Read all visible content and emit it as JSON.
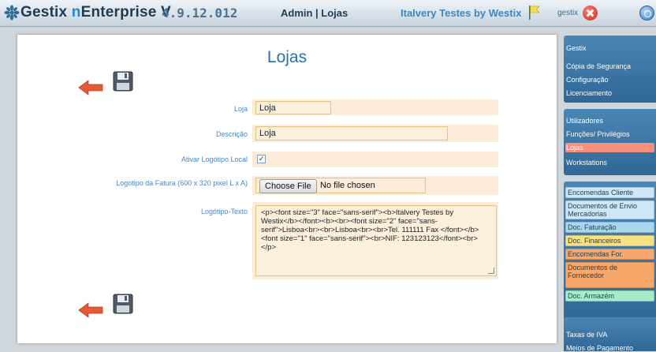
{
  "header": {
    "brand_prefix": "Gestix ",
    "brand_n": "n",
    "brand_suffix": "Enterprise V",
    "version": "4.9.12.012",
    "breadcrumb": "Admin | Lojas",
    "company": "Italvery Testes by Westix",
    "user": "gestix",
    "icons": [
      "gestix-star-icon",
      "flag-icon",
      "close-icon",
      "info-icon"
    ]
  },
  "page": {
    "title": "Lojas"
  },
  "form": {
    "loja_label": "Loja",
    "loja_value": "Loja",
    "descricao_label": "Descrição",
    "descricao_value": "Loja",
    "ativar_label": "Ativar Logótipo Local",
    "ativar_checked": true,
    "ativar_mark": "✓",
    "logotipo_label": "Logotipo da Fatura (600 x 320 pixel L x A)",
    "file_button": "Choose File",
    "file_status": "No file chosen",
    "texto_label": "Logótipo-Texto",
    "texto_value": "<p><font size=\"3\" face=\"sans-serif\"><b>Italvery Testes by Westix</b></font><b><br><font size=\"2\" face=\"sans-serif\">Lisboa<br><br>Lisboa<br><br>Tel. 111111 Fax </font></b><font size=\"1\" face=\"sans-serif\"><br>NIF: 123123123</font><br></p>"
  },
  "sidebar": {
    "group1": [
      "Gestix",
      "Cópia de Segurança",
      "Configuração",
      "Licenciamento"
    ],
    "group2": [
      "Utilizadores",
      "Funções/ Privilégios",
      "Lojas",
      "Workstations"
    ],
    "group2_selected": "Lojas",
    "group3": [
      {
        "label": "Encomendas Cliente",
        "color": "#cfe6f5"
      },
      {
        "label": "Documentos de Envio Mercadorias",
        "color": "#cfe6f5"
      },
      {
        "label": "Doc. Faturação",
        "color": "#a9d6ef"
      },
      {
        "label": "Doc. Financeiros",
        "color": "#f7e184"
      },
      {
        "label": "Encomendas For.",
        "color": "#f7a86a"
      },
      {
        "label": "Documentos de Fornecedor",
        "color": "#f7a86a"
      },
      {
        "label": "Doc. Armazém",
        "color": "#a6ecc9"
      }
    ],
    "group4": [
      "Taxas de IVA",
      "Meios de Pagamento"
    ]
  }
}
